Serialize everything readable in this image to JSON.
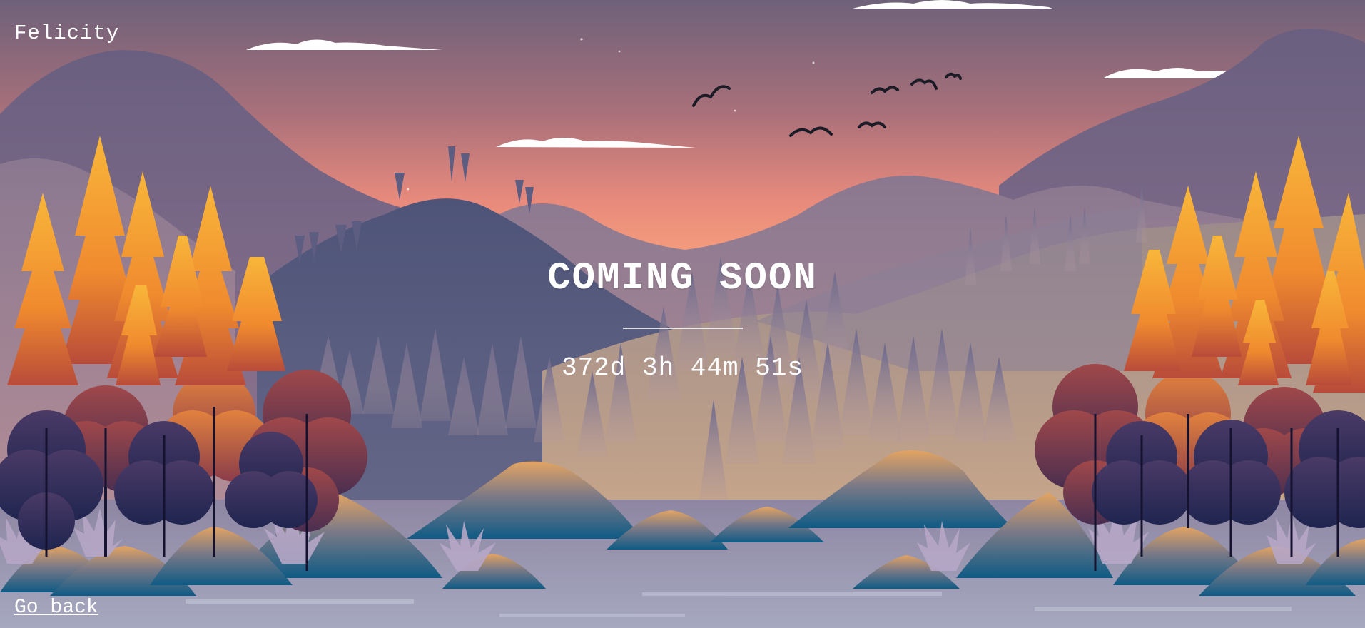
{
  "brand": "Felicity",
  "hero": {
    "title": "COMING SOON",
    "countdown": "372d 3h 44m 51s"
  },
  "footer": {
    "back_link": "Go back"
  },
  "colors": {
    "sky_top": "#6e617a",
    "sky_horizon": "#f59a7e",
    "tree_orange": "#f5a033",
    "tree_dark": "#2e2a55",
    "mound_teal": "#1d5f82",
    "text": "#ffffff"
  }
}
